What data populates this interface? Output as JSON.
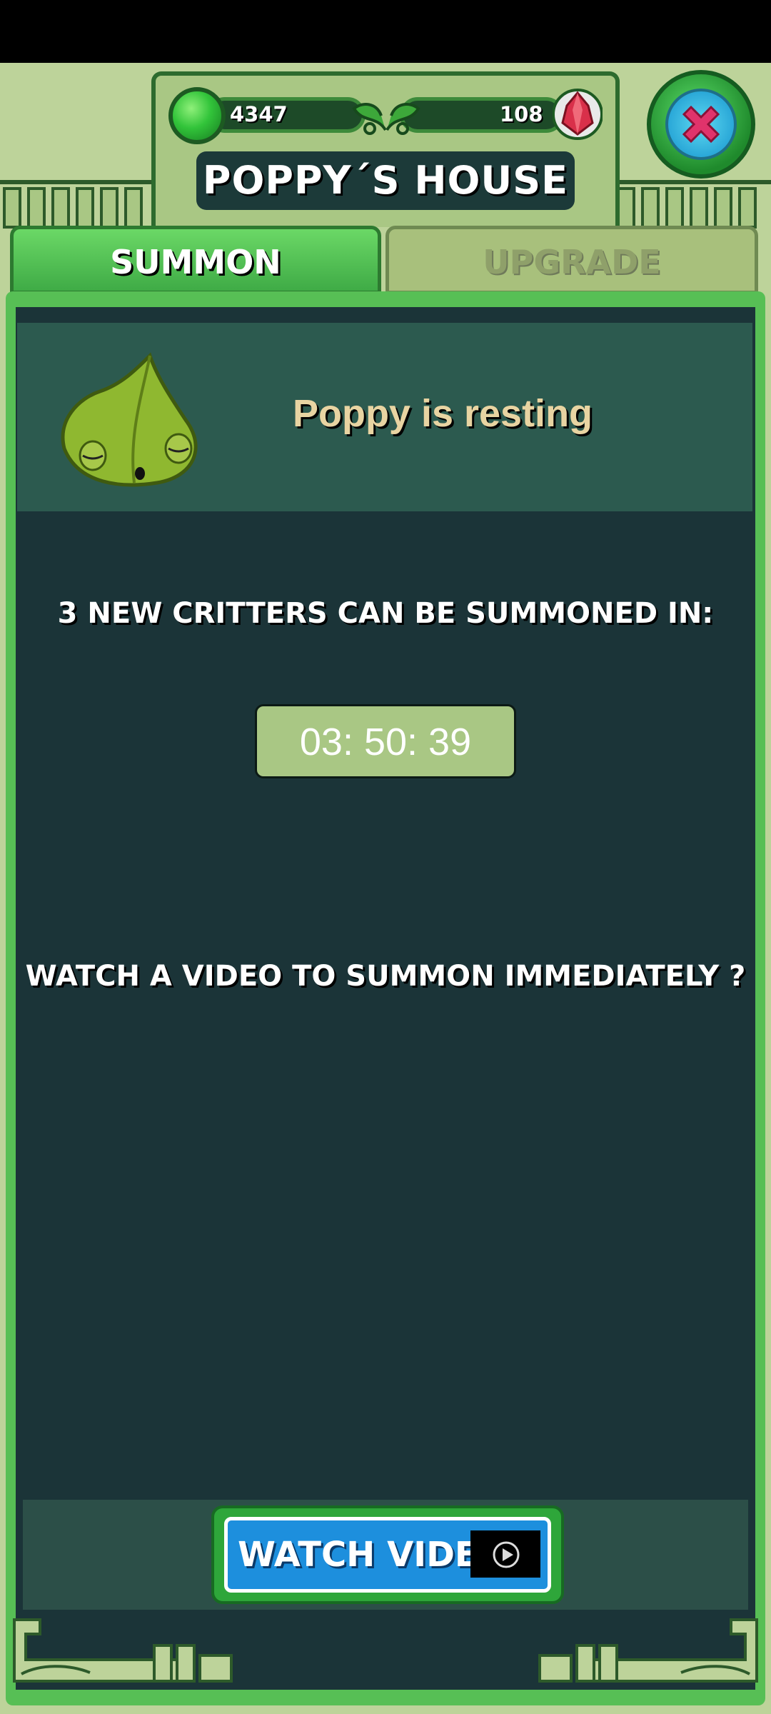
{
  "header": {
    "slime_count": "4347",
    "gem_count": "108",
    "title": "POPPY´S HOUSE"
  },
  "tabs": [
    {
      "label": "SUMMON",
      "active": true
    },
    {
      "label": "UPGRADE",
      "active": false
    }
  ],
  "critter": {
    "status": "Poppy is resting"
  },
  "summon": {
    "info": "3 NEW CRITTERS CAN BE SUMMONED IN:",
    "timer": "03: 50: 39",
    "prompt": "WATCH A VIDEO TO SUMMON IMMEDIATELY ?",
    "button_label": "WATCH VIDEO"
  },
  "icons": {
    "resource_left": "green-slime-icon",
    "resource_right": "red-gem-icon",
    "close": "close-icon",
    "play": "play-icon"
  },
  "colors": {
    "panel_bg": "#1b3438",
    "panel_border": "#57bf55",
    "button_blue": "#1d8fdd",
    "close_x": "#e0336b"
  }
}
